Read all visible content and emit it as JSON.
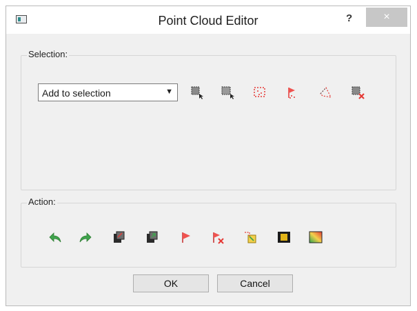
{
  "window": {
    "title": "Point Cloud Editor",
    "help_label": "?",
    "close_label": "×"
  },
  "selection": {
    "group_label": "Selection:",
    "mode_value": "Add to selection",
    "tools": [
      {
        "icon": "rect-select-icon"
      },
      {
        "icon": "rect-select-front-icon"
      },
      {
        "icon": "rect-select-dotted-icon"
      },
      {
        "icon": "flag-select-icon"
      },
      {
        "icon": "lasso-select-icon"
      },
      {
        "icon": "clear-selection-icon"
      }
    ]
  },
  "action": {
    "group_label": "Action:",
    "tools": [
      {
        "icon": "undo-icon"
      },
      {
        "icon": "redo-icon"
      },
      {
        "icon": "export-selection-icon"
      },
      {
        "icon": "import-selection-icon"
      },
      {
        "icon": "flag-icon"
      },
      {
        "icon": "unflag-icon"
      },
      {
        "icon": "paste-points-icon"
      },
      {
        "icon": "height-map-icon"
      },
      {
        "icon": "color-gradient-icon"
      }
    ]
  },
  "buttons": {
    "ok": "OK",
    "cancel": "Cancel"
  },
  "colors": {
    "accent_green": "#3fa34d",
    "accent_red": "#e53935",
    "frame_gray": "#f0f0f0"
  }
}
